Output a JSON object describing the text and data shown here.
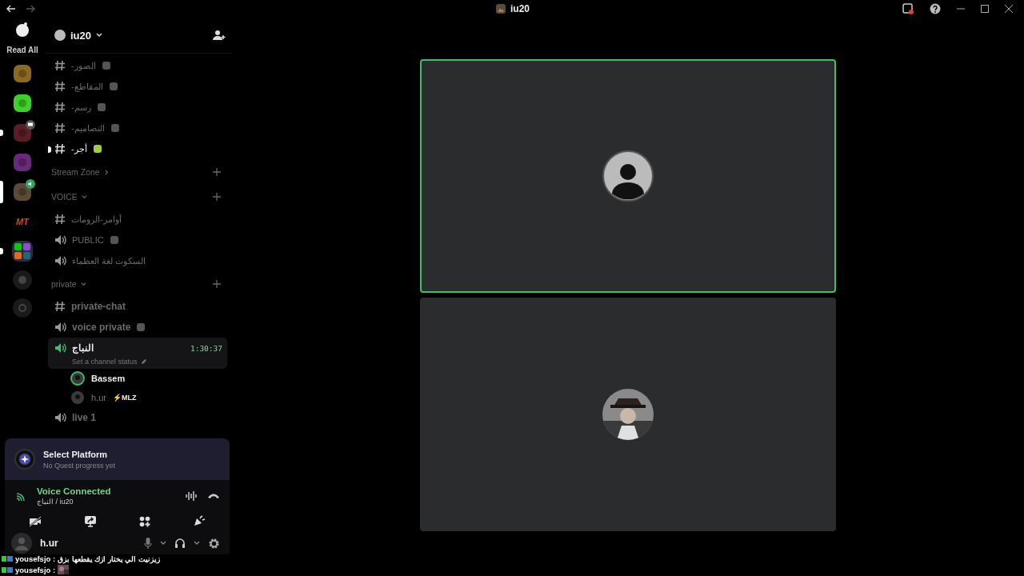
{
  "titlebar": {
    "title": "iu20"
  },
  "rail": {
    "read_all": "Read All",
    "servers": [
      {
        "kind": "picture",
        "color": "#8a6a20",
        "selected": false,
        "unread": false,
        "screen_share": false,
        "in_voice": false
      },
      {
        "kind": "picture",
        "color": "#3fd12a",
        "selected": false,
        "unread": false,
        "screen_share": false,
        "in_voice": false
      },
      {
        "kind": "picture",
        "color": "#5a1e26",
        "selected": false,
        "unread": true,
        "screen_share": true,
        "in_voice": false
      },
      {
        "kind": "picture",
        "color": "#6a2a7a",
        "selected": false,
        "unread": false,
        "screen_share": false,
        "in_voice": false
      },
      {
        "kind": "picture",
        "color": "#5c4a36",
        "selected": true,
        "unread": false,
        "screen_share": false,
        "in_voice": true
      },
      {
        "kind": "label",
        "label": "MT",
        "color": "#e0401c",
        "selected": false,
        "unread": false,
        "screen_share": false,
        "in_voice": false
      },
      {
        "kind": "folder",
        "color": "#2f2a40",
        "selected": false,
        "unread": true,
        "screen_share": false,
        "in_voice": false
      }
    ]
  },
  "server": {
    "name": "iu20"
  },
  "items": [
    {
      "kind": "text",
      "name": "-الصور",
      "unread": false,
      "emoji": true
    },
    {
      "kind": "text",
      "name": "-المقاطع",
      "unread": false,
      "emoji": true
    },
    {
      "kind": "text",
      "name": "-رسم",
      "unread": false,
      "emoji": true
    },
    {
      "kind": "text",
      "name": "-التصاميم",
      "unread": false,
      "emoji": true
    },
    {
      "kind": "text",
      "name": "-أجر",
      "unread": true,
      "emoji": true
    },
    {
      "kind": "category",
      "name": "Stream Zone",
      "expanded": false
    },
    {
      "kind": "category",
      "name": "VOICE",
      "expanded": true
    },
    {
      "kind": "text",
      "name": "أوامر-الرومات",
      "unread": false,
      "emoji": false
    },
    {
      "kind": "voice",
      "name": "PUBLIC",
      "unread": false,
      "emoji": true
    },
    {
      "kind": "voice",
      "name": "السكوت لغة العظماء",
      "unread": false,
      "emoji": false
    },
    {
      "kind": "category",
      "name": "private",
      "expanded": true
    },
    {
      "kind": "private_text",
      "name": "private-chat",
      "unread": false,
      "emoji": false
    },
    {
      "kind": "private_voice",
      "name": "voice private",
      "unread": false,
      "emoji": true
    },
    {
      "kind": "private_voice",
      "name": "النباج",
      "unread": false,
      "emoji": false,
      "active": true,
      "timer": "1:30:37",
      "status": "Set a channel status",
      "children": [
        {
          "name": "Bassem",
          "speaking": true
        },
        {
          "name": "h.ur",
          "speaking": false,
          "tag": "⚡MLZ"
        }
      ]
    },
    {
      "kind": "private_voice",
      "name": "live 1",
      "unread": false,
      "emoji": false
    }
  ],
  "tiles": [
    {
      "speaking": true,
      "kind": "silhouette"
    },
    {
      "speaking": false,
      "kind": "picture"
    }
  ],
  "quest": {
    "title": "Select Platform",
    "subtitle": "No Quest progress yet"
  },
  "voice": {
    "status": "Voice Connected",
    "location": "النباج / iu20"
  },
  "user": {
    "name": "h.ur"
  },
  "chat": [
    {
      "user": "yousefsjo :",
      "kind": "text",
      "message": "زيزنيت الي يختار ازك يقطعها بزق"
    },
    {
      "user": "yousefsjo :",
      "kind": "emote"
    }
  ]
}
